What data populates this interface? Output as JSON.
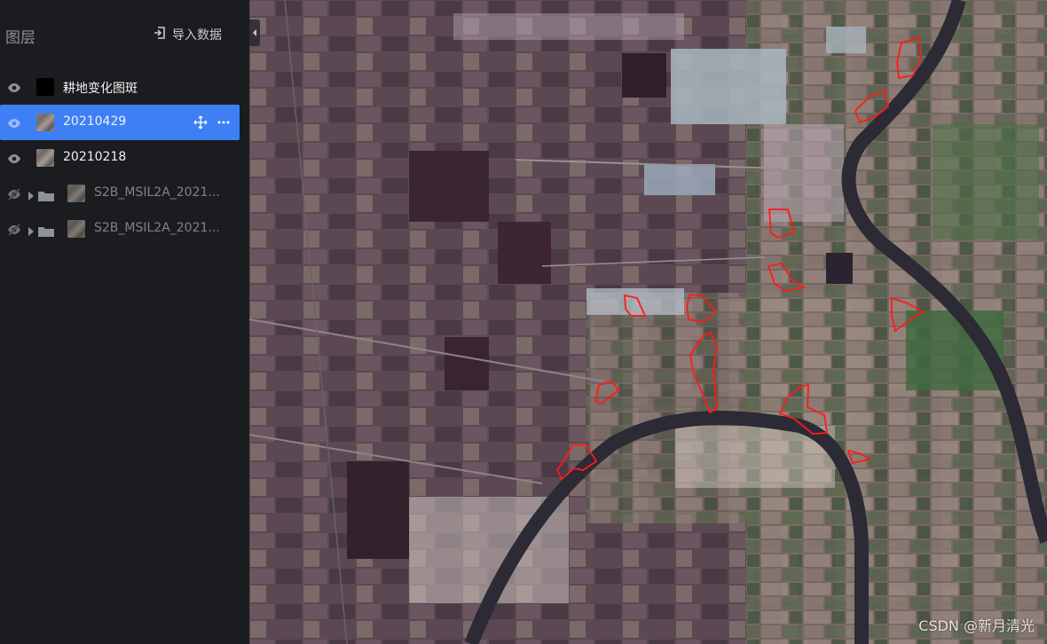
{
  "sidebar": {
    "title": "图层",
    "import_label": "导入数据",
    "layers": [
      {
        "name": "耕地变化图斑",
        "visible": true,
        "thumbnail": "black-swatch",
        "selected": false,
        "group": false
      },
      {
        "name": "20210429",
        "visible": true,
        "thumbnail": "satellite-thumbnail",
        "selected": true,
        "group": false
      },
      {
        "name": "20210218",
        "visible": true,
        "thumbnail": "satellite-thumbnail",
        "selected": false,
        "group": false
      },
      {
        "name": "S2B_MSIL2A_2021...",
        "visible": false,
        "thumbnail": "satellite-thumbnail",
        "selected": false,
        "group": true
      },
      {
        "name": "S2B_MSIL2A_2021...",
        "visible": false,
        "thumbnail": "satellite-thumbnail",
        "selected": false,
        "group": true
      }
    ]
  },
  "map": {
    "watermark": "CSDN @新月清光",
    "change_polygon_color": "#ff1a1a",
    "river_color": "#2b2a35"
  },
  "colors": {
    "sidebar_bg": "#1b1c1f",
    "selected_row": "#3f7ff6"
  }
}
